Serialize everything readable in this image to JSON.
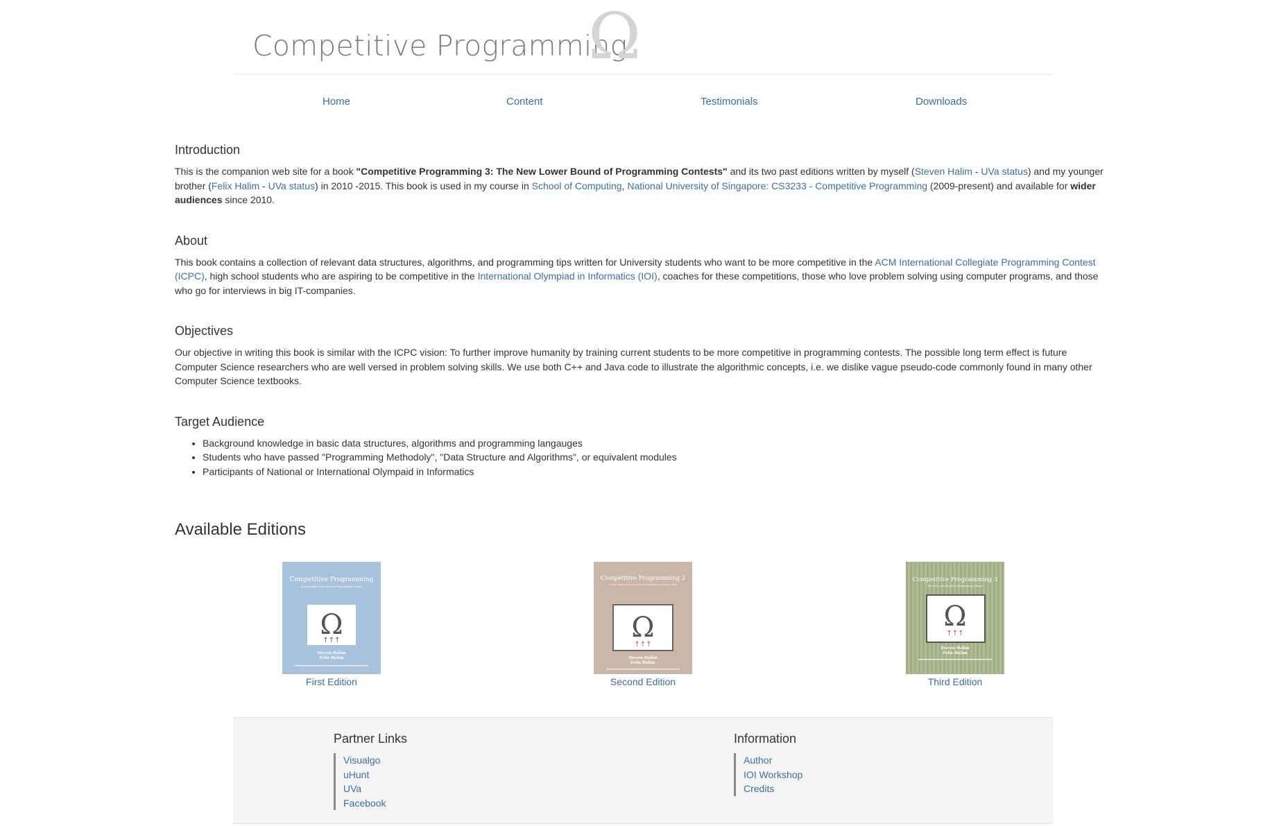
{
  "header": {
    "title": "Competitive Programming"
  },
  "nav": {
    "items": [
      "Home",
      "Content",
      "Testimonials",
      "Downloads"
    ]
  },
  "intro": {
    "heading": "Introduction",
    "t1": "This is the companion web site for a book ",
    "book_title": "\"Competitive Programming 3: The New Lower Bound of Programming Contests\"",
    "t2": " and its two past editions written by myself (",
    "l_steven": "Steven Halim",
    "dash1": " - ",
    "l_uva1": "UVa status",
    "t3": ") and my younger brother (",
    "l_felix": "Felix Halim",
    "dash2": " - ",
    "l_uva2": "UVa status",
    "t4": ") in 2010 -2015. This book is used in my course in ",
    "l_soc": "School of Computing",
    "comma": ", ",
    "l_nus": "National University of Singapore",
    "colon": ": ",
    "l_cs3233": "CS3233 - Competitive Programming",
    "t5": " (2009-present) and available for ",
    "wider": "wider audiences",
    "t6": " since 2010."
  },
  "about": {
    "heading": "About",
    "t1": "This book contains a collection of relevant data structures, algorithms, and programming tips written for University students who want to be more competitive in the ",
    "l_icpc": "ACM International Collegiate Programming Contest (ICPC)",
    "t2": ", high school students who are aspiring to be competitive in the ",
    "l_ioi": "International Olympiad in Informatics (IOI)",
    "t3": ", coaches for these competitions, those who love problem solving using computer programs, and those who go for interviews in big IT-companies."
  },
  "objectives": {
    "heading": "Objectives",
    "text": "Our objective in writing this book is similar with the ICPC vision: To further improve humanity by training current students to be more competitive in programming contests. The possible long term effect is future Computer Science researchers who are well versed in problem solving skills. We use both C++ and Java code to illustrate the algorithmic concepts, i.e. we dislike vague pseudo-code commonly found in many other Computer Science textbooks."
  },
  "audience": {
    "heading": "Target Audience",
    "items": [
      "Background knowledge in basic data structures, algorithms and programming langauges",
      "Students who have passed \"Programming Methodoly\", \"Data Structure and Algorithms\", or equivalent modules",
      "Participants of National or International Olympaid in Informatics"
    ]
  },
  "editions": {
    "heading": "Available Editions",
    "items": [
      {
        "label": "First Edition",
        "cover_title": "Competitive Programming",
        "cover_subtitle": "Increasing the Lower Bound of Programming Contests",
        "authors": [
          "Steven Halim",
          "Felix Halim"
        ],
        "color": "#a9c3dc"
      },
      {
        "label": "Second Edition",
        "cover_title": "Competitive Programming 2",
        "cover_subtitle": "This increases the lower bound of Programming Contests. Again",
        "authors": [
          "Steven Halim",
          "Felix Halim"
        ],
        "color": "#cbb7a9"
      },
      {
        "label": "Third Edition",
        "cover_title": "Competitive Programming 3",
        "cover_subtitle": "The New Lower Bound of Programming Contests",
        "authors": [
          "Steven Halim",
          "Felix Halim"
        ],
        "color": "#a7b58e"
      }
    ]
  },
  "footer": {
    "partner": {
      "heading": "Partner Links",
      "links": [
        "Visualgo",
        "uHunt",
        "UVa",
        "Facebook"
      ]
    },
    "info": {
      "heading": "Information",
      "links": [
        "Author",
        "IOI Workshop",
        "Credits"
      ]
    }
  },
  "colors": {
    "link": "#3e6ea0",
    "text": "#333333",
    "footer_bg": "#f5f5f5"
  }
}
